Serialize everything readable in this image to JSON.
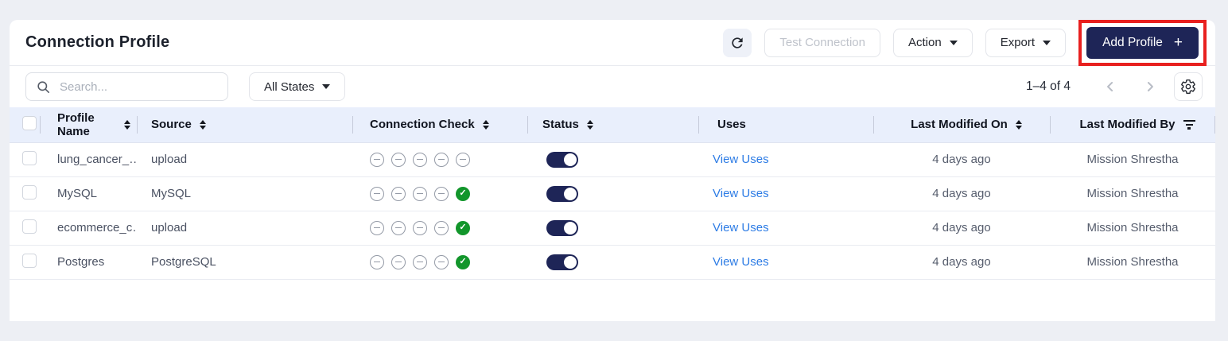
{
  "header": {
    "title": "Connection Profile",
    "test_connection_label": "Test Connection",
    "action_label": "Action",
    "export_label": "Export",
    "add_profile_label": "Add Profile",
    "add_profile_plus": "+"
  },
  "toolbar": {
    "search_placeholder": "Search...",
    "state_filter_label": "All States",
    "pagination_range": "1–4 of 4"
  },
  "table": {
    "columns": [
      {
        "label": "Profile Name",
        "sort": true
      },
      {
        "label": "Source",
        "sort": true
      },
      {
        "label": "Connection Check",
        "sort": true
      },
      {
        "label": "Status",
        "sort": true
      },
      {
        "label": "Uses",
        "sort": false
      },
      {
        "label": "Last Modified On",
        "sort": true
      },
      {
        "label": "Last Modified By",
        "filter": true
      }
    ],
    "rows": [
      {
        "profile_name": "lung_cancer_…",
        "source": "upload",
        "connection_check": [
          "minus",
          "minus",
          "minus",
          "minus",
          "minus"
        ],
        "status_on": true,
        "uses_link": "View Uses",
        "last_modified_on": "4 days ago",
        "last_modified_by": "Mission Shrestha"
      },
      {
        "profile_name": "MySQL",
        "source": "MySQL",
        "connection_check": [
          "minus",
          "minus",
          "minus",
          "minus",
          "check"
        ],
        "status_on": true,
        "uses_link": "View Uses",
        "last_modified_on": "4 days ago",
        "last_modified_by": "Mission Shrestha"
      },
      {
        "profile_name": "ecommerce_c…",
        "source": "upload",
        "connection_check": [
          "minus",
          "minus",
          "minus",
          "minus",
          "check"
        ],
        "status_on": true,
        "uses_link": "View Uses",
        "last_modified_on": "4 days ago",
        "last_modified_by": "Mission Shrestha"
      },
      {
        "profile_name": "Postgres",
        "source": "PostgreSQL",
        "connection_check": [
          "minus",
          "minus",
          "minus",
          "minus",
          "check"
        ],
        "status_on": true,
        "uses_link": "View Uses",
        "last_modified_on": "4 days ago",
        "last_modified_by": "Mission Shrestha"
      }
    ]
  },
  "colors": {
    "accent-navy": "#1e2557",
    "annotation-red": "#e8201f",
    "link-blue": "#2d7ce5",
    "success-green": "#12962b",
    "header-bg": "#e9effc",
    "page-bg": "#edeff4"
  }
}
